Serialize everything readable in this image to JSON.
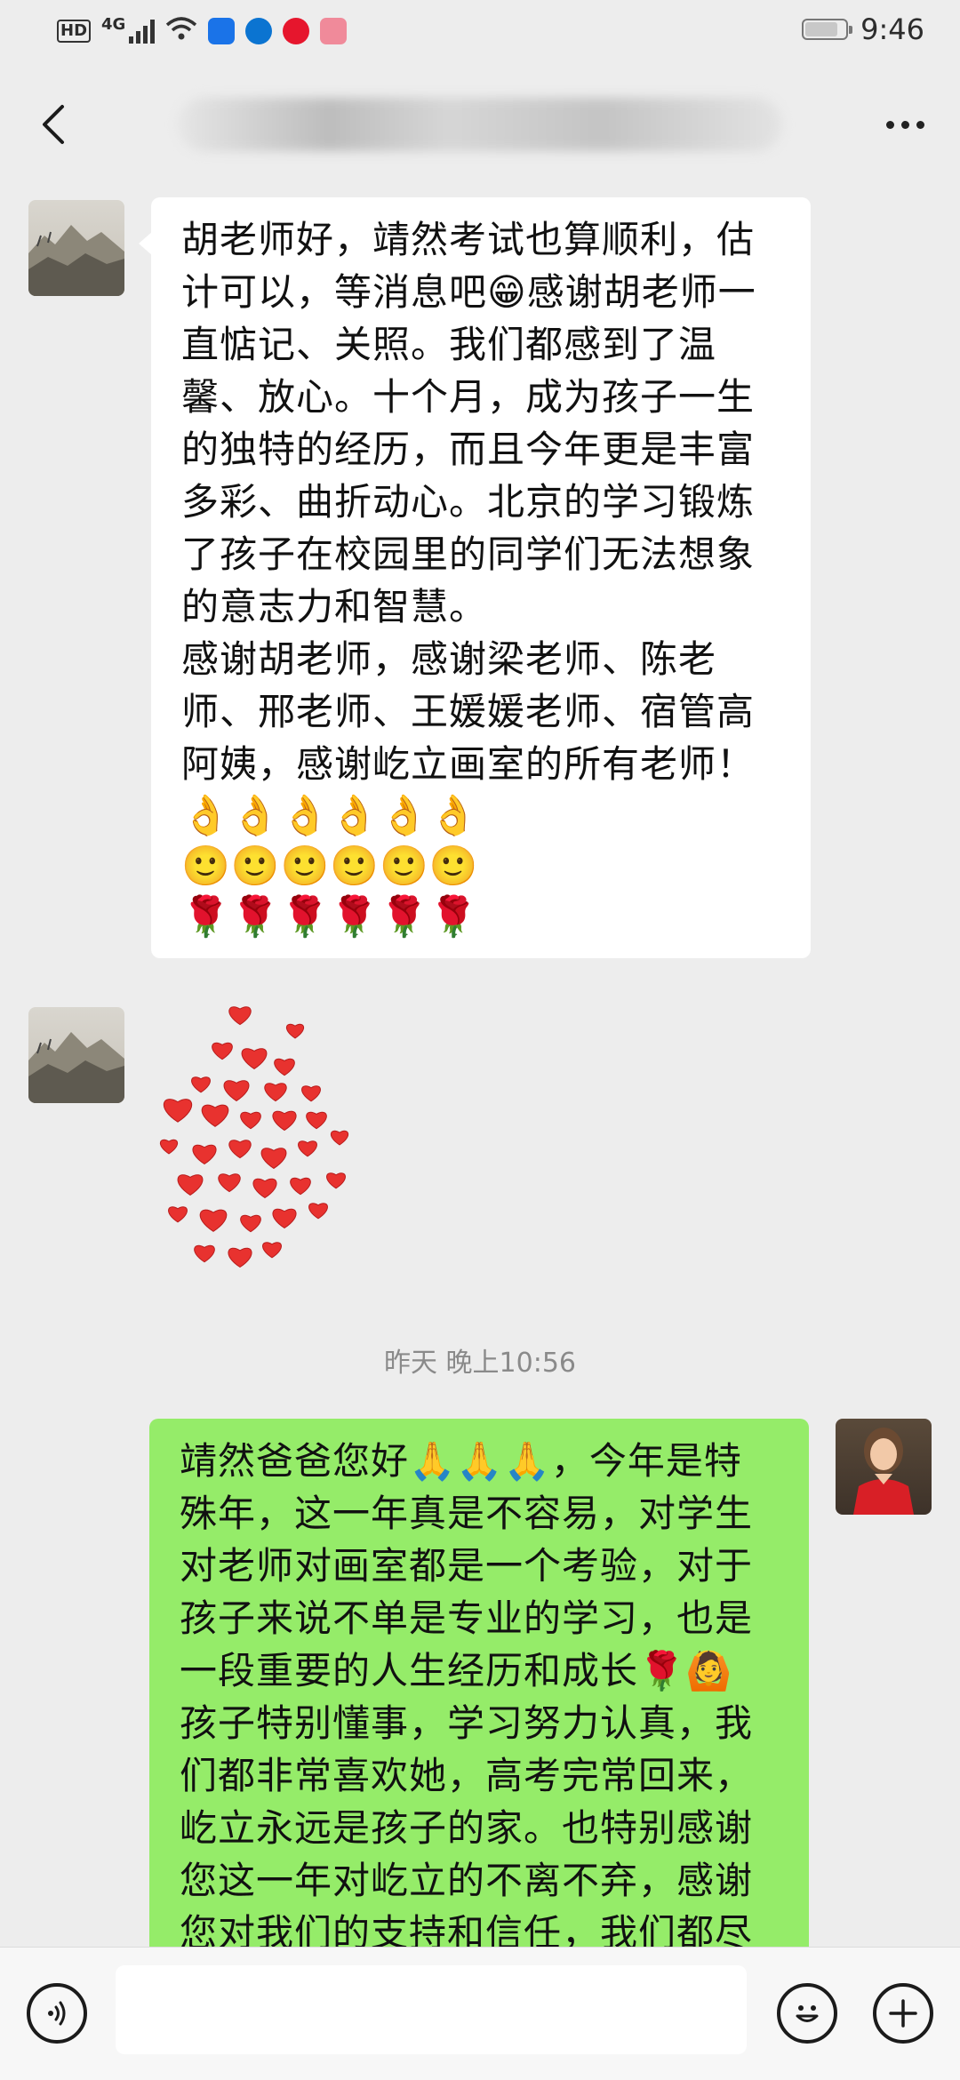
{
  "status_bar": {
    "hd": "HD",
    "network": "4G",
    "time": "9:46",
    "app_icon_colors": [
      "#1a73e8",
      "#0b74d1",
      "#e6162d",
      "#f08a9a"
    ]
  },
  "header": {
    "title": "",
    "back_icon": "chevron-left-icon",
    "more_icon": "more-dots-icon"
  },
  "messages": [
    {
      "side": "left",
      "type": "text",
      "lines": [
        "胡老师好，靖然考试也算顺利，估",
        "计可以，等消息吧😁感谢胡老师一",
        "直惦记、关照。我们都感到了温",
        "馨、放心。十个月，成为孩子一生",
        "的独特的经历，而且今年更是丰富",
        "多彩、曲折动心。北京的学习锻炼",
        "了孩子在校园里的同学们无法想象",
        "的意志力和智慧。",
        "感谢胡老师，感谢梁老师、陈老",
        "师、邢老师、王媛媛老师、宿管高",
        "阿姨，感谢屹立画室的所有老师！"
      ],
      "emoji_rows": [
        "👌👌👌👌👌👌",
        "🙂🙂🙂🙂🙂🙂",
        "🌹🌹🌹🌹🌹🌹"
      ]
    },
    {
      "side": "left",
      "type": "sticker",
      "sticker": "hearts-sticker"
    },
    {
      "type": "timestamp",
      "text": "昨天 晚上10:56"
    },
    {
      "side": "right",
      "type": "text",
      "lines": [
        "靖然爸爸您好🙏🙏🙏，今年是特",
        "殊年，这一年真是不容易，对学生",
        "对老师对画室都是一个考验，对于",
        "孩子来说不单是专业的学习，也是",
        "一段重要的人生经历和成长🌹🙆",
        "孩子特别懂事，学习努力认真，我",
        "们都非常喜欢她，高考完常回来，",
        "屹立永远是孩子的家。也特别感谢",
        "您这一年对屹立的不离不弃，感谢",
        "您对我们的支持和信任，我们都尽"
      ]
    }
  ],
  "input_bar": {
    "voice_icon": "voice-icon",
    "emoji_icon": "emoji-icon",
    "plus_icon": "plus-icon",
    "placeholder": ""
  },
  "colors": {
    "background": "#ededed",
    "bubble_sent": "#95ec69",
    "bubble_received": "#ffffff",
    "heart": "#e8322f"
  }
}
